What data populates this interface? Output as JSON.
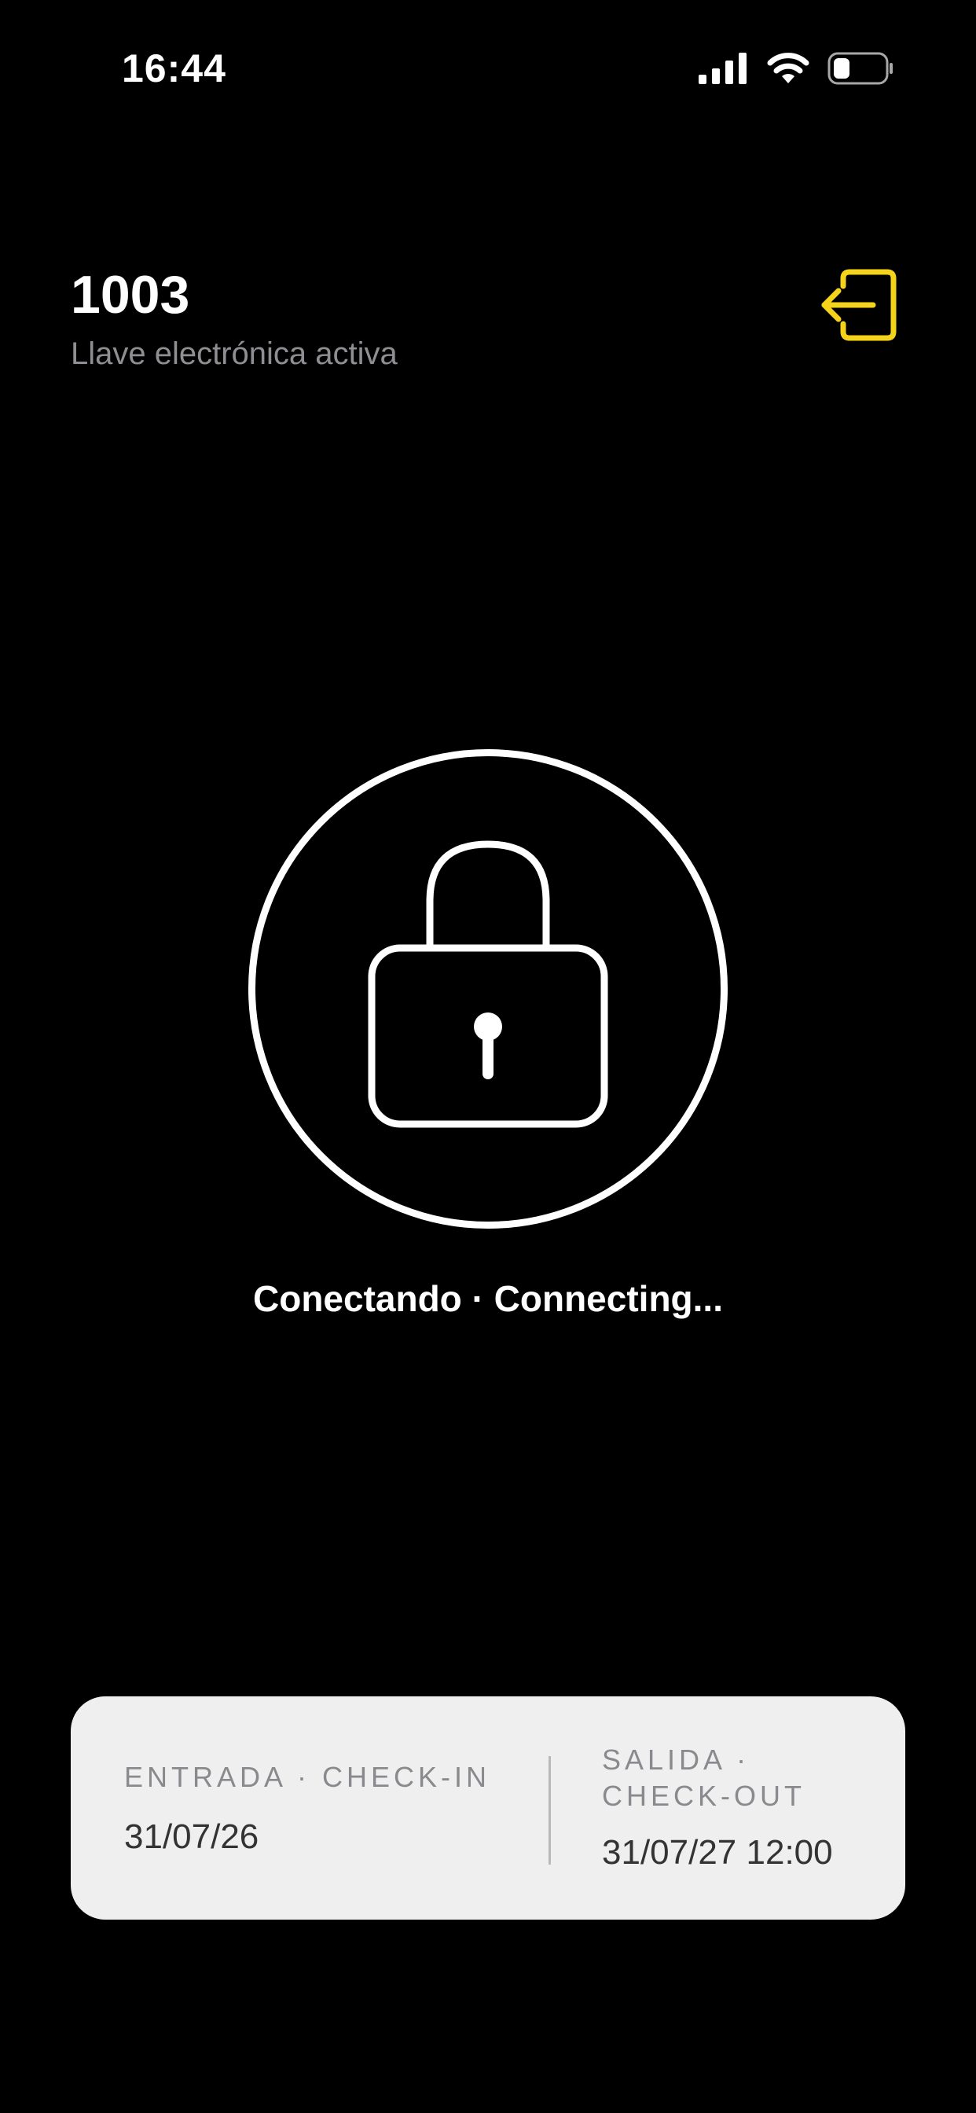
{
  "status_bar": {
    "time": "16:44",
    "icons": [
      "signal-icon",
      "wifi-icon",
      "battery-icon"
    ]
  },
  "header": {
    "room_number": "1003",
    "subtitle": "Llave electrónica activa",
    "logout_icon": "logout-icon"
  },
  "lock": {
    "icon": "lock-icon",
    "status": "Conectando · Connecting..."
  },
  "stay": {
    "checkin_label": "ENTRADA · CHECK-IN",
    "checkin_value": "31/07/26",
    "checkout_label": "SALIDA · CHECK-OUT",
    "checkout_value": "31/07/27 12:00"
  },
  "colors": {
    "background": "#000000",
    "accent": "#f5d31b",
    "card": "#efefef",
    "subtitle": "#8e8e93"
  }
}
